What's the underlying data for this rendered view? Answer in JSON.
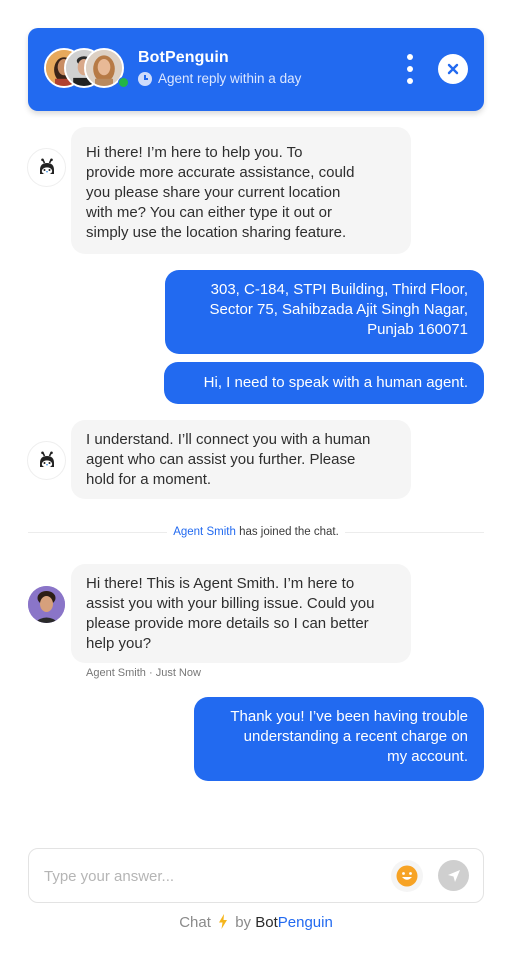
{
  "header": {
    "title": "BotPenguin",
    "status": "Agent reply within a day",
    "online": true,
    "icons": {
      "menu": "more-vertical-icon",
      "close": "close-icon",
      "status": "clock-icon"
    }
  },
  "colors": {
    "primary": "#226af0",
    "incoming_bubble": "#f5f5f5",
    "online": "#22b547",
    "emoji": "#f7a325",
    "send_disabled": "#cfcfcf",
    "bolt": "#f5b51b"
  },
  "messages": [
    {
      "sender": "bot",
      "lines": [
        "Hi there!        I’m here to help you. To",
        "provide more accurate assistance, could",
        "you please share your current location",
        "with me? You can either type it out or",
        "simply use the location sharing feature."
      ]
    },
    {
      "sender": "user",
      "lines": [
        "303, C-184, STPI Building, Third Floor,",
        "Sector 75, Sahibzada Ajit Singh Nagar,",
        "Punjab 160071"
      ]
    },
    {
      "sender": "user",
      "lines": [
        "Hi, I need to speak with a human agent."
      ]
    },
    {
      "sender": "bot",
      "lines": [
        "I understand. I’ll connect you with a human",
        "agent who can assist you further. Please",
        "hold for a moment."
      ]
    },
    {
      "sender": "agent",
      "lines": [
        "Hi there! This is Agent Smith. I’m here to",
        "assist you with your billing issue. Could you",
        "please provide more details so I can better",
        "help you?"
      ],
      "meta": "Agent Smith · Just Now"
    },
    {
      "sender": "user",
      "lines": [
        "Thank you! I’ve been having trouble",
        "understanding a recent charge on",
        "my account."
      ]
    }
  ],
  "system_notice": {
    "agent_name": "Agent Smith",
    "text": "has joined the chat."
  },
  "composer": {
    "placeholder": "Type your answer...",
    "value": "",
    "emoji_icon": "smile-icon",
    "send_icon": "send-icon"
  },
  "footer": {
    "chat": "Chat",
    "bolt": "⚡",
    "by": "by",
    "brand_part1": "Bot",
    "brand_part2": "Penguin"
  }
}
